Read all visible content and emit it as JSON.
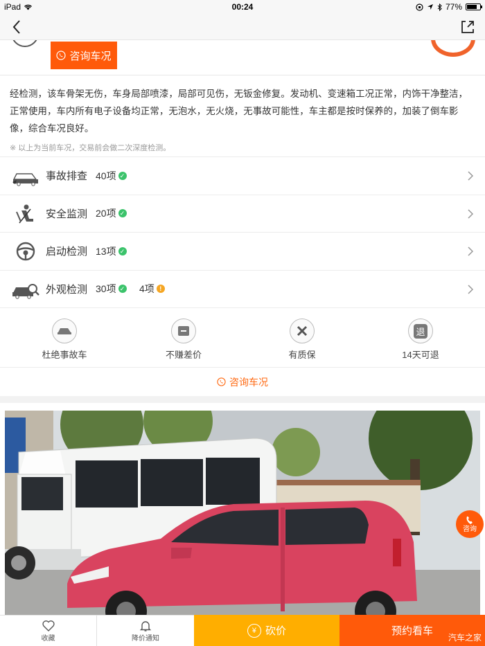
{
  "status_bar": {
    "device": "iPad",
    "time": "00:24",
    "battery": "77%",
    "battery_level": 0.77
  },
  "nav": {
    "back_icon": "chevron-left-icon",
    "share_icon": "share-icon"
  },
  "header": {
    "consult_button": "咨询车况"
  },
  "description": {
    "text": "经检测，该车骨架无伤，车身局部喷漆，局部可见伤，无钣金修复。发动机、变速箱工况正常，内饰干净整洁，正常使用，车内所有电子设备均正常，无泡水，无火烧，无事故可能性，车主都是按时保养的，加装了倒车影像，综合车况良好。",
    "note": "※ 以上为当前车况，交易前会做二次深度检测。"
  },
  "checks": [
    {
      "label": "事故排查",
      "count": "40项",
      "warn": ""
    },
    {
      "label": "安全监测",
      "count": "20项",
      "warn": ""
    },
    {
      "label": "启动检测",
      "count": "13项",
      "warn": ""
    },
    {
      "label": "外观检测",
      "count": "30项",
      "warn": "4项"
    }
  ],
  "guarantees": [
    {
      "label": "杜绝事故车"
    },
    {
      "label": "不赚差价"
    },
    {
      "label": "有质保"
    },
    {
      "label": "14天可退",
      "icon_text": "退"
    }
  ],
  "consult_link": "咨询车况",
  "float_consult": "咨询",
  "bottom_bar": {
    "favorite": "收藏",
    "price_notify": "降价通知",
    "bargain": "砍价",
    "book": "预约看车",
    "watermark": "汽车之家"
  },
  "colors": {
    "accent": "#ff5a0a",
    "bargain": "#ffae00",
    "ok": "#3bc36b",
    "warn": "#f5a623"
  }
}
